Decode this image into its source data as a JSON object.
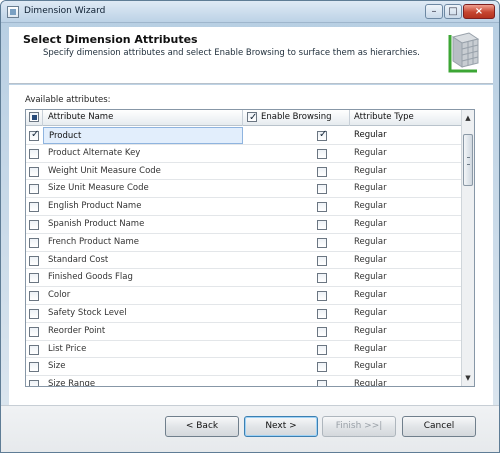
{
  "window": {
    "title": "Dimension Wizard"
  },
  "header": {
    "title": "Select Dimension Attributes",
    "subtitle": "Specify dimension attributes and select Enable Browsing to surface them as hierarchies."
  },
  "attributes": {
    "label": "Available attributes:",
    "columns": [
      "Attribute Name",
      "Enable Browsing",
      "Attribute Type"
    ],
    "rows": [
      {
        "name": "Product",
        "enable_browsing": true,
        "type": "Regular",
        "checked": true
      },
      {
        "name": "Product Alternate Key",
        "enable_browsing": false,
        "type": "Regular",
        "checked": false
      },
      {
        "name": "Weight Unit Measure Code",
        "enable_browsing": false,
        "type": "Regular",
        "checked": false
      },
      {
        "name": "Size Unit Measure Code",
        "enable_browsing": false,
        "type": "Regular",
        "checked": false
      },
      {
        "name": "English Product Name",
        "enable_browsing": false,
        "type": "Regular",
        "checked": false
      },
      {
        "name": "Spanish Product Name",
        "enable_browsing": false,
        "type": "Regular",
        "checked": false
      },
      {
        "name": "French Product Name",
        "enable_browsing": false,
        "type": "Regular",
        "checked": false
      },
      {
        "name": "Standard Cost",
        "enable_browsing": false,
        "type": "Regular",
        "checked": false
      },
      {
        "name": "Finished Goods Flag",
        "enable_browsing": false,
        "type": "Regular",
        "checked": false
      },
      {
        "name": "Color",
        "enable_browsing": false,
        "type": "Regular",
        "checked": false
      },
      {
        "name": "Safety Stock Level",
        "enable_browsing": false,
        "type": "Regular",
        "checked": false
      },
      {
        "name": "Reorder Point",
        "enable_browsing": false,
        "type": "Regular",
        "checked": false
      },
      {
        "name": "List Price",
        "enable_browsing": false,
        "type": "Regular",
        "checked": false
      },
      {
        "name": "Size",
        "enable_browsing": false,
        "type": "Regular",
        "checked": false
      },
      {
        "name": "Size Range",
        "enable_browsing": false,
        "type": "Regular",
        "checked": false
      }
    ]
  },
  "footer": {
    "back": "< Back",
    "next": "Next >",
    "finish": "Finish >>|",
    "cancel": "Cancel"
  }
}
